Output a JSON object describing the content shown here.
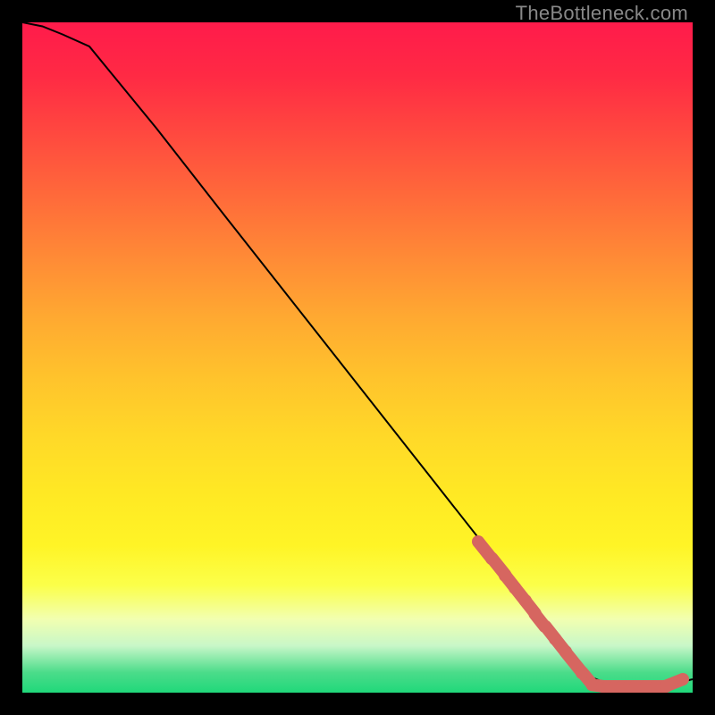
{
  "watermark": "TheBottleneck.com",
  "chart_data": {
    "type": "line",
    "title": "",
    "xlabel": "",
    "ylabel": "",
    "xlim": [
      0,
      100
    ],
    "ylim": [
      0,
      100
    ],
    "curve": {
      "name": "bottleneck-curve",
      "x": [
        0,
        3,
        6,
        10,
        20,
        30,
        40,
        50,
        60,
        70,
        78,
        84,
        88,
        92,
        96,
        100
      ],
      "y": [
        100,
        99.4,
        98.2,
        96.4,
        84.2,
        71.4,
        58.7,
        46.0,
        33.3,
        20.6,
        10.4,
        2.7,
        1.0,
        1.0,
        1.0,
        2.0
      ]
    },
    "markers": {
      "name": "highlighted-points",
      "color": "#d66660",
      "x": [
        68,
        70,
        72,
        73.5,
        75,
        76.5,
        78,
        79.5,
        81,
        83.5,
        85,
        86.5,
        87.5,
        88.5,
        89.5,
        90.5,
        91.5,
        93,
        94.5,
        96,
        98.5
      ],
      "y": [
        22.5,
        20.0,
        17.5,
        15.6,
        13.7,
        11.8,
        9.9,
        8.0,
        6.1,
        3.0,
        1.2,
        1.0,
        1.0,
        1.0,
        1.0,
        1.0,
        1.0,
        1.0,
        1.0,
        1.0,
        2.0
      ]
    },
    "gradient_stops": [
      {
        "pos": 0.0,
        "color": "#ff1b4b"
      },
      {
        "pos": 0.5,
        "color": "#ffc32c"
      },
      {
        "pos": 0.8,
        "color": "#fbff4a"
      },
      {
        "pos": 0.97,
        "color": "#4bdc8a"
      },
      {
        "pos": 1.0,
        "color": "#20d87a"
      }
    ]
  }
}
